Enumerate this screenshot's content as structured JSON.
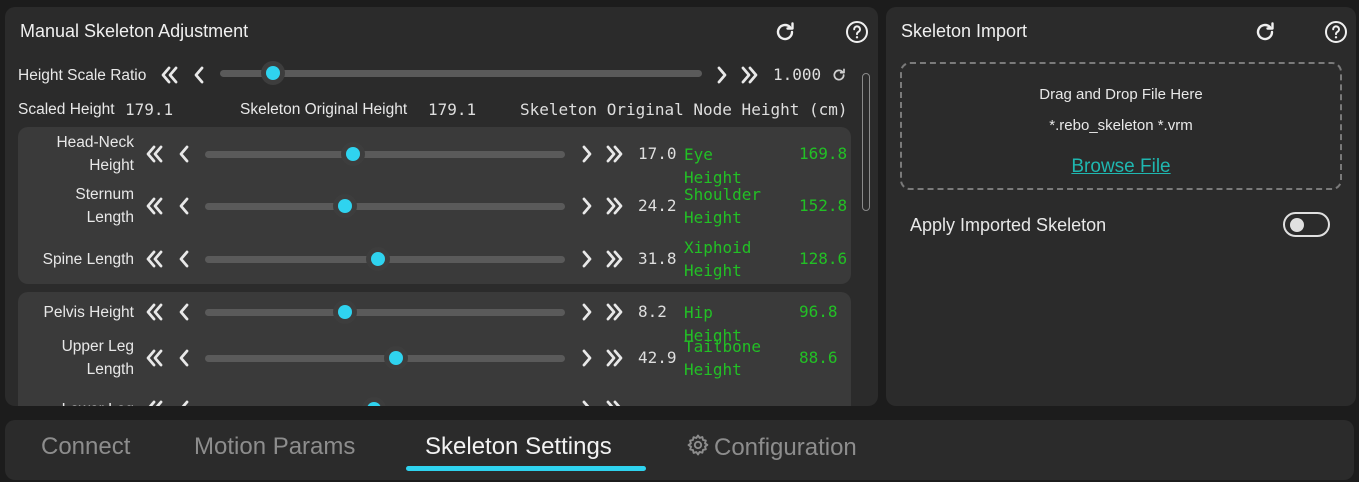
{
  "manual_panel": {
    "title": "Manual Skeleton Adjustment",
    "height_scale": {
      "label": "Height Scale Ratio",
      "value_text": "1.000",
      "slider_fraction": 0.11
    },
    "scaled_height": {
      "label": "Scaled Height",
      "value": "179.1"
    },
    "original_height": {
      "label": "Skeleton Original Height",
      "value": "179.1"
    },
    "node_height_header": "Skeleton Original Node Height (cm)",
    "rows": [
      {
        "label_lines": [
          "Head-Neck",
          "Height"
        ],
        "value": "17.0",
        "fraction": 0.41,
        "node_lines": [
          "Eye Height"
        ],
        "node_value": "169.8"
      },
      {
        "label_lines": [
          "Sternum",
          "Length"
        ],
        "value": "24.2",
        "fraction": 0.39,
        "node_lines": [
          "Shoulder",
          "Height"
        ],
        "node_value": "152.8"
      },
      {
        "label_lines": [
          "Spine Length"
        ],
        "value": "31.8",
        "fraction": 0.48,
        "node_lines": [
          "Xiphoid",
          "Height"
        ],
        "node_value": "128.6"
      },
      {
        "label_lines": [
          "Pelvis Height"
        ],
        "value": "8.2",
        "fraction": 0.39,
        "node_lines": [
          "Hip Height"
        ],
        "node_value": "96.8"
      },
      {
        "label_lines": [
          "Upper Leg",
          "Length"
        ],
        "value": "42.9",
        "fraction": 0.53,
        "node_lines": [
          "Tailbone",
          "Height"
        ],
        "node_value": "88.6"
      },
      {
        "label_lines": [
          "Lower Leg"
        ],
        "value": "",
        "fraction": 0.47,
        "node_lines": [
          ""
        ],
        "node_value": ""
      }
    ]
  },
  "import_panel": {
    "title": "Skeleton Import",
    "drop_text": "Drag and Drop File Here",
    "extensions": "*.rebo_skeleton *.vrm",
    "browse_label": "Browse File",
    "apply_label": "Apply Imported Skeleton",
    "apply_enabled": false
  },
  "tabs": [
    {
      "label": "Connect",
      "active": false
    },
    {
      "label": "Motion Params",
      "active": false
    },
    {
      "label": "Skeleton Settings",
      "active": true
    },
    {
      "label": "Configuration",
      "active": false,
      "icon": "gear-icon"
    }
  ],
  "colors": {
    "accent": "#2fd3ef",
    "node_text": "#22c025",
    "link": "#1fb7b0",
    "panel": "#2b2b2b"
  }
}
